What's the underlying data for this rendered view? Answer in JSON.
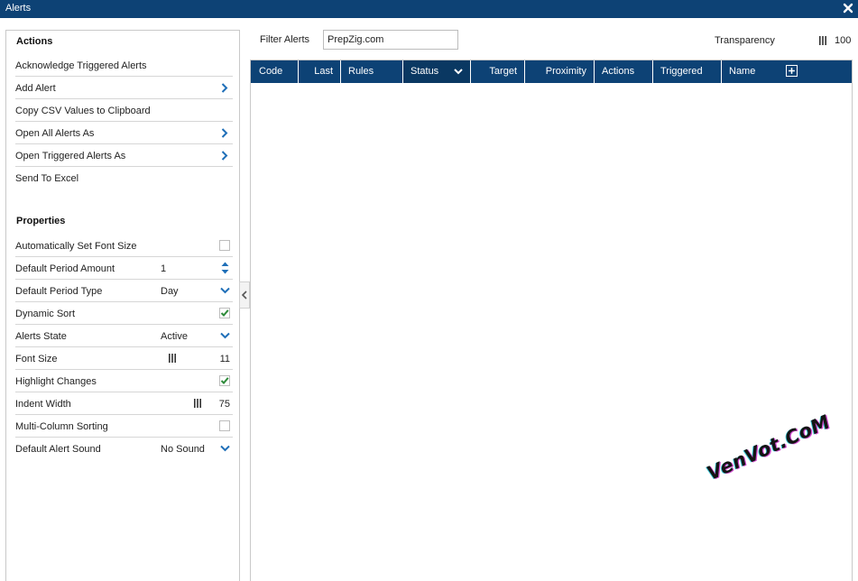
{
  "window": {
    "title": "Alerts"
  },
  "actions": {
    "title": "Actions",
    "items": [
      {
        "label": "Acknowledge Triggered Alerts",
        "submenu": false
      },
      {
        "label": "Add Alert",
        "submenu": true
      },
      {
        "label": "Copy CSV Values to Clipboard",
        "submenu": false
      },
      {
        "label": "Open All Alerts As",
        "submenu": true
      },
      {
        "label": "Open Triggered Alerts As",
        "submenu": true
      },
      {
        "label": "Send To Excel",
        "submenu": false
      }
    ]
  },
  "properties": {
    "title": "Properties",
    "items": [
      {
        "label": "Automatically Set Font Size",
        "type": "checkbox",
        "checked": false
      },
      {
        "label": "Default Period Amount",
        "type": "stepper",
        "value": "1"
      },
      {
        "label": "Default Period Type",
        "type": "dropdown",
        "value": "Day"
      },
      {
        "label": "Dynamic Sort",
        "type": "checkbox",
        "checked": true
      },
      {
        "label": "Alerts State",
        "type": "dropdown",
        "value": "Active"
      },
      {
        "label": "Font Size",
        "type": "slider",
        "value": "11"
      },
      {
        "label": "Highlight Changes",
        "type": "checkbox",
        "checked": true
      },
      {
        "label": "Indent Width",
        "type": "slider",
        "value": "75"
      },
      {
        "label": "Multi-Column Sorting",
        "type": "checkbox",
        "checked": false
      },
      {
        "label": "Default Alert Sound",
        "type": "dropdown",
        "value": "No Sound"
      }
    ]
  },
  "filter": {
    "label": "Filter Alerts",
    "value": "PrepZig.com"
  },
  "transparency": {
    "label": "Transparency",
    "value": "100"
  },
  "grid": {
    "columns": [
      "Code",
      "Last",
      "Rules",
      "Status",
      "Target",
      "Proximity",
      "Actions",
      "Triggered",
      "Name"
    ]
  },
  "watermark": "VenVot.CoM",
  "colors": {
    "header_bg": "#0d4275",
    "check_green": "#2e8b3a",
    "chevron_blue": "#1f6fb8"
  }
}
